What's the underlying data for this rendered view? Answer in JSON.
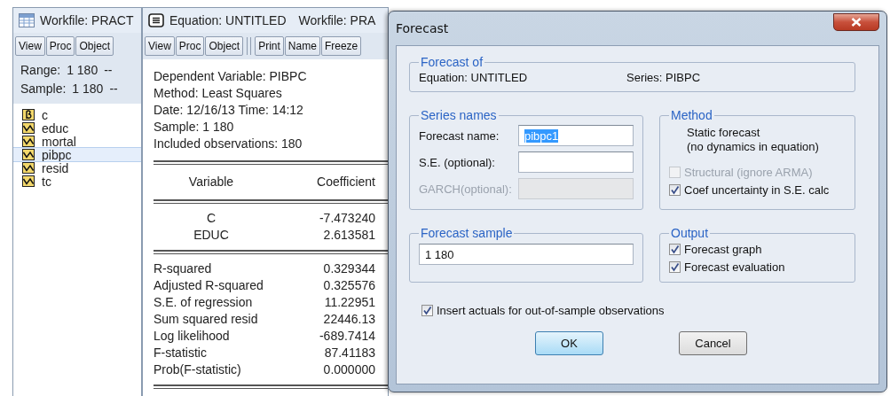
{
  "workfile_window": {
    "title": "Workfile: PRACT",
    "toolbar": [
      "View",
      "Proc",
      "Object"
    ],
    "info": [
      {
        "label": "Range:",
        "value": "1 180",
        "tail": "--"
      },
      {
        "label": "Sample:",
        "value": "1 180",
        "tail": "--"
      }
    ],
    "objects": [
      {
        "name": "c",
        "kind": "coef",
        "selected": false
      },
      {
        "name": "educ",
        "kind": "series",
        "selected": false
      },
      {
        "name": "mortal",
        "kind": "series",
        "selected": false
      },
      {
        "name": "pibpc",
        "kind": "series",
        "selected": true
      },
      {
        "name": "resid",
        "kind": "series",
        "selected": false
      },
      {
        "name": "tc",
        "kind": "series",
        "selected": false
      }
    ]
  },
  "equation_window": {
    "title": "Equation: UNTITLED",
    "workfile": "Workfile: PRA",
    "toolbar": [
      "View",
      "Proc",
      "Object"
    ],
    "toolbar_2": [
      "Print",
      "Name",
      "Freeze"
    ],
    "header": [
      "Dependent Variable: PIBPC",
      "Method: Least Squares",
      "Date: 12/16/13   Time: 14:12",
      "Sample: 1 180",
      "Included observations: 180"
    ],
    "columns": [
      "Variable",
      "Coefficient"
    ],
    "rows": [
      {
        "variable": "C",
        "coefficient": "-7.473240"
      },
      {
        "variable": "EDUC",
        "coefficient": "2.613581"
      }
    ],
    "stats": [
      {
        "label": "R-squared",
        "value": "0.329344"
      },
      {
        "label": "Adjusted R-squared",
        "value": "0.325576"
      },
      {
        "label": "S.E. of regression",
        "value": "11.22951"
      },
      {
        "label": "Sum squared resid",
        "value": "22446.13"
      },
      {
        "label": "Log likelihood",
        "value": "-689.7414"
      },
      {
        "label": "F-statistic",
        "value": "87.41183"
      },
      {
        "label": "Prob(F-statistic)",
        "value": "0.000000"
      }
    ]
  },
  "dialog": {
    "title": "Forecast",
    "forecast_of": {
      "legend": "Forecast of",
      "equation": "Equation: UNTITLED",
      "series": "Series: PIBPC"
    },
    "series_names": {
      "legend": "Series names",
      "fields": [
        {
          "label": "Forecast name:",
          "value": "pibpc1",
          "selected": true,
          "disabled": false
        },
        {
          "label": "S.E. (optional):",
          "disabled": false
        },
        {
          "label": "GARCH(optional):",
          "disabled": true
        }
      ]
    },
    "method": {
      "legend": "Method",
      "lines": [
        "Static forecast",
        "(no dynamics in equation)"
      ],
      "options": [
        {
          "label": "Structural (ignore ARMA)",
          "checked": false,
          "disabled": true
        },
        {
          "label": "Coef uncertainty in S.E. calc",
          "checked": true,
          "disabled": false
        }
      ]
    },
    "forecast_sample": {
      "legend": "Forecast sample",
      "value": "1 180"
    },
    "output": {
      "legend": "Output",
      "options": [
        {
          "label": "Forecast graph",
          "checked": true,
          "disabled": false
        },
        {
          "label": "Forecast evaluation",
          "checked": true,
          "disabled": false
        }
      ]
    },
    "insert_actuals": {
      "label": "Insert actuals for out-of-sample observations",
      "checked": true
    },
    "buttons": [
      {
        "label": "OK",
        "default": true
      },
      {
        "label": "Cancel",
        "default": false
      }
    ]
  }
}
